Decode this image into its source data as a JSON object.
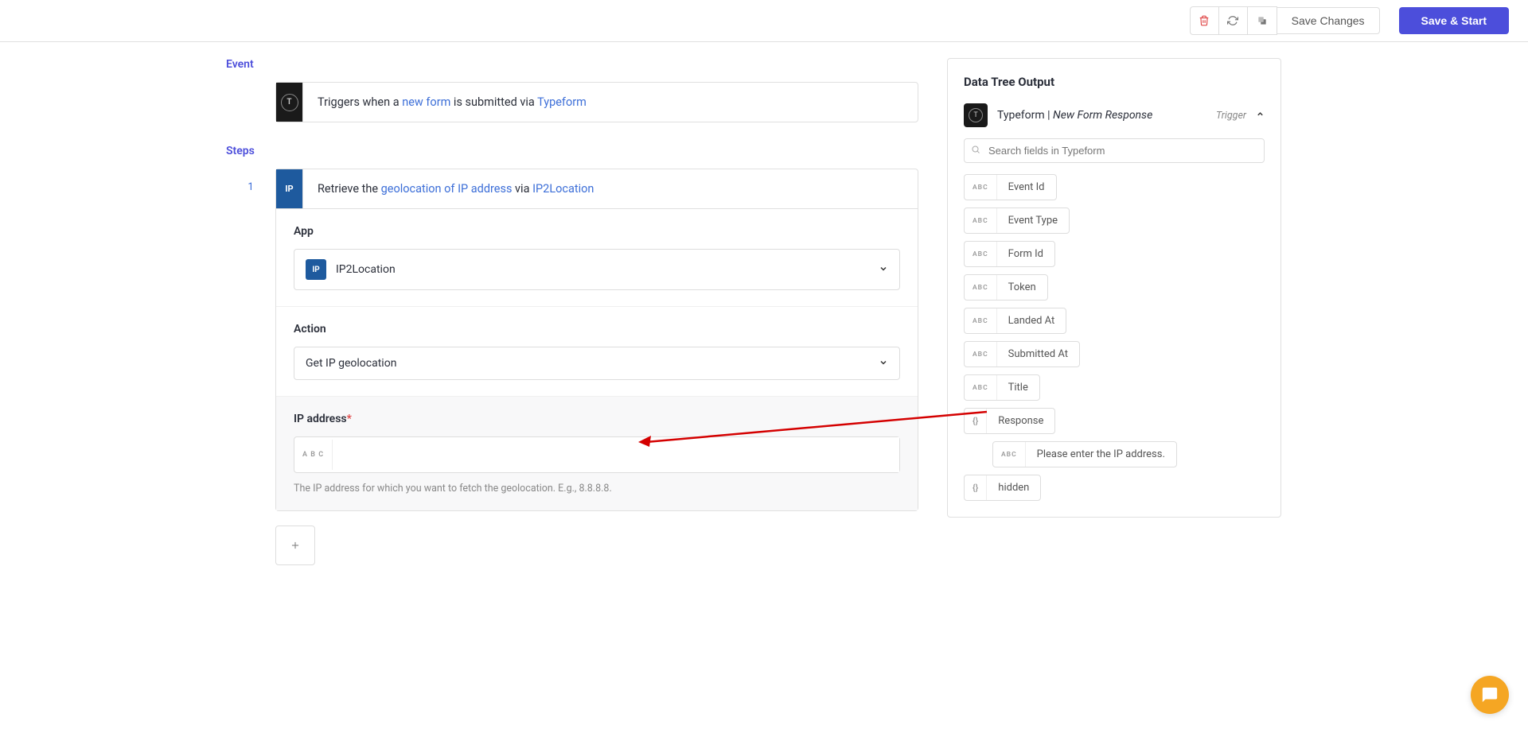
{
  "topbar": {
    "save_changes": "Save Changes",
    "save_start": "Save & Start"
  },
  "event": {
    "section_label": "Event",
    "icon_letter": "T",
    "text_prefix": "Triggers when a ",
    "link1": "new form",
    "text_mid": " is submitted via ",
    "link2": "Typeform"
  },
  "steps": {
    "section_label": "Steps",
    "items": [
      {
        "num": "1",
        "icon_text": "IP",
        "header_prefix": "Retrieve the ",
        "header_link1": "geolocation of IP address",
        "header_mid": " via ",
        "header_link2": "IP2Location",
        "app_label": "App",
        "app_value": "IP2Location",
        "app_icon": "IP",
        "action_label": "Action",
        "action_value": "Get IP geolocation",
        "ip_label": "IP address",
        "ip_helper": "The IP address for which you want to fetch the geolocation. E.g., 8.8.8.8."
      }
    ]
  },
  "data_tree": {
    "title": "Data Tree Output",
    "app_icon": "T",
    "app_name": "Typeform",
    "event_name": "New Form Response",
    "badge": "Trigger",
    "search_placeholder": "Search fields in Typeform",
    "fields": [
      {
        "type": "ABC",
        "name": "Event Id"
      },
      {
        "type": "ABC",
        "name": "Event Type"
      },
      {
        "type": "ABC",
        "name": "Form Id"
      },
      {
        "type": "ABC",
        "name": "Token"
      },
      {
        "type": "ABC",
        "name": "Landed At"
      },
      {
        "type": "ABC",
        "name": "Submitted At"
      },
      {
        "type": "ABC",
        "name": "Title"
      },
      {
        "type": "{}",
        "name": "Response"
      },
      {
        "type": "ABC",
        "name": "Please enter the IP address."
      },
      {
        "type": "{}",
        "name": "hidden"
      }
    ]
  }
}
